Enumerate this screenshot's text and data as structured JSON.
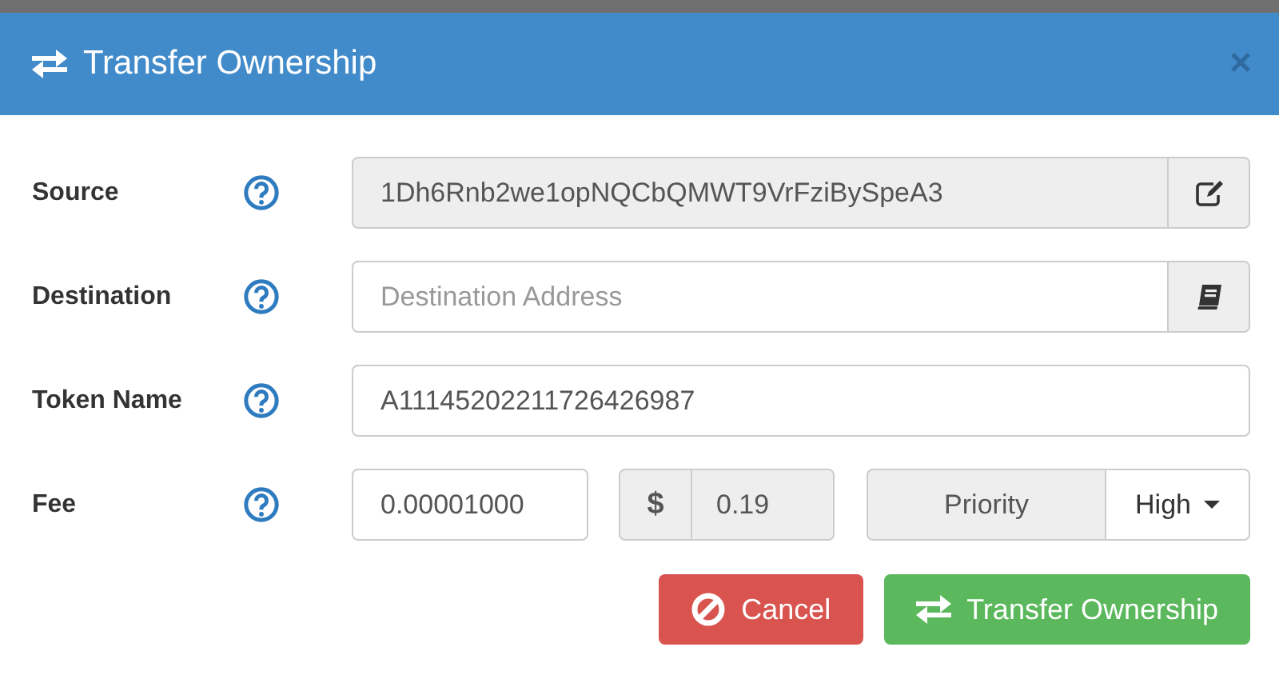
{
  "dialog": {
    "title": "Transfer Ownership",
    "close": "×"
  },
  "fields": [
    {
      "kind": "source",
      "label": "Source",
      "value": "1Dh6Rnb2we1opNQCbQMWT9VrFziBySpeA3",
      "readonly": true
    },
    {
      "kind": "destination",
      "label": "Destination",
      "placeholder": "Destination Address",
      "readonly": false
    },
    {
      "kind": "text",
      "label": "Token Name",
      "value": "A11145202211726426987",
      "readonly": false
    },
    {
      "kind": "fee",
      "label": "Fee",
      "value": "0.00001000",
      "currency": "$",
      "fiat": "0.19",
      "priority_label": "Priority",
      "priority": "High"
    }
  ],
  "buttons": [
    {
      "kind": "cancel",
      "label": "Cancel"
    },
    {
      "kind": "submit",
      "label": "Transfer Ownership"
    }
  ]
}
